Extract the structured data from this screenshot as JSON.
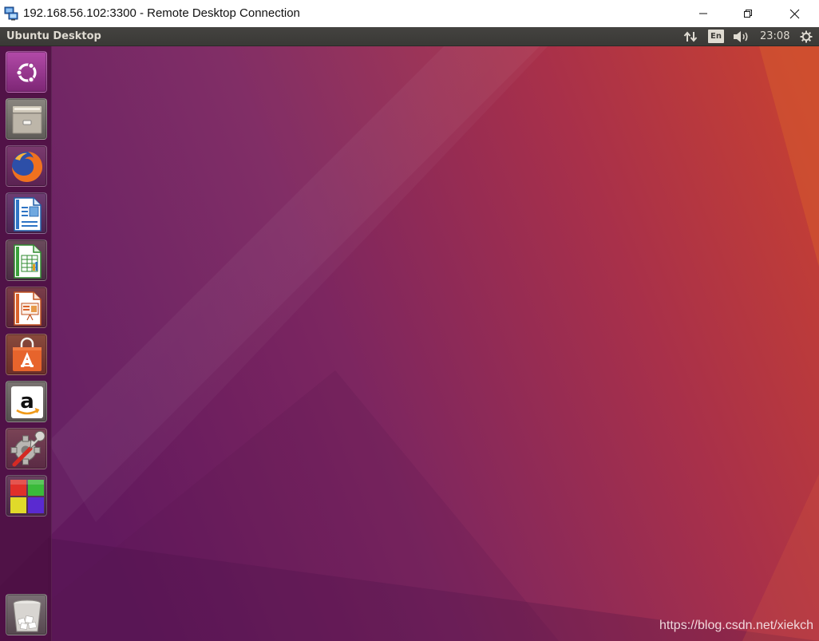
{
  "window": {
    "title": "192.168.56.102:3300 - Remote Desktop Connection",
    "icon": "remote-desktop-icon",
    "controls": [
      "minimize",
      "restore",
      "close"
    ]
  },
  "top_panel": {
    "title": "Ubuntu Desktop",
    "indicators": {
      "network": "network-updown-icon",
      "keyboard_layout": "En",
      "sound": "speaker-icon",
      "clock": "23:08",
      "session": "gear-icon"
    }
  },
  "launcher": {
    "items": [
      {
        "name": "dash",
        "icon": "ubuntu-logo-icon"
      },
      {
        "name": "files",
        "icon": "file-cabinet-icon"
      },
      {
        "name": "firefox",
        "icon": "firefox-icon"
      },
      {
        "name": "libreoffice-writer",
        "icon": "writer-icon"
      },
      {
        "name": "libreoffice-calc",
        "icon": "calc-icon"
      },
      {
        "name": "libreoffice-impress",
        "icon": "impress-icon"
      },
      {
        "name": "ubuntu-software",
        "icon": "software-bag-icon"
      },
      {
        "name": "amazon",
        "icon": "amazon-icon"
      },
      {
        "name": "system-settings",
        "icon": "settings-tools-icon"
      },
      {
        "name": "workspace-switcher",
        "icon": "workspaces-icon"
      },
      {
        "name": "trash",
        "icon": "trash-icon"
      }
    ]
  },
  "watermark": "https://blog.csdn.net/xiekch",
  "colors": {
    "panel": "#3c3b37",
    "wallpaper_left": "#6a1f63",
    "wallpaper_right": "#c5412f",
    "launcher": "#4a0f3f"
  }
}
